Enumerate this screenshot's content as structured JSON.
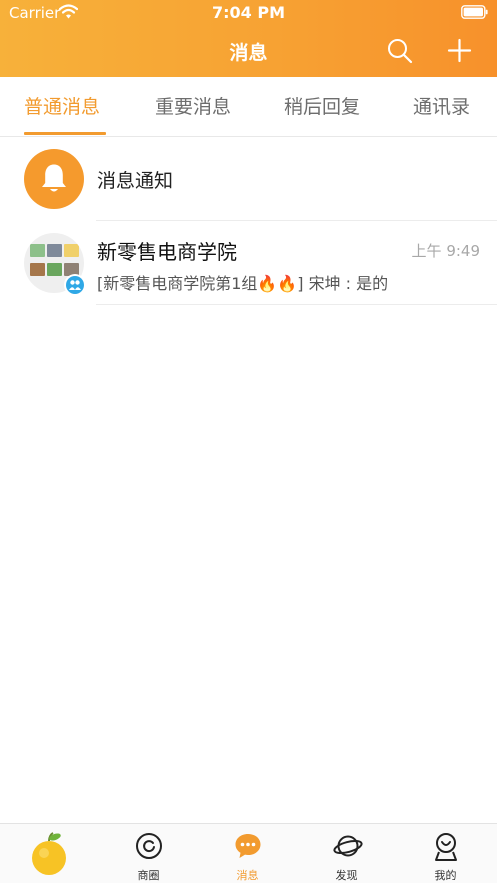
{
  "status_bar": {
    "carrier": "Carrier",
    "time": "7:04 PM"
  },
  "nav": {
    "title": "消息",
    "search_icon": "search-icon",
    "add_icon": "plus-icon"
  },
  "tabs": [
    {
      "label": "普通消息",
      "active": true
    },
    {
      "label": "重要消息",
      "active": false
    },
    {
      "label": "稍后回复",
      "active": false
    },
    {
      "label": "通讯录",
      "active": false
    }
  ],
  "conversations": {
    "notice": {
      "title": "消息通知",
      "icon": "bell-icon"
    },
    "group": {
      "title": "新零售电商学院",
      "time": "上午 9:49",
      "preview": "[新零售电商学院第1组🔥🔥] 宋坤 : 是的"
    }
  },
  "tabbar": [
    {
      "label": "",
      "icon": "fruit-logo-icon"
    },
    {
      "label": "商圈",
      "icon": "ring-icon"
    },
    {
      "label": "消息",
      "icon": "chat-bubble-icon",
      "active": true
    },
    {
      "label": "发现",
      "icon": "planet-icon"
    },
    {
      "label": "我的",
      "icon": "profile-icon"
    }
  ],
  "colors": {
    "accent": "#f29b2f",
    "header_start": "#f7b13a",
    "header_end": "#f7912b",
    "group_badge": "#2fa8e6"
  }
}
